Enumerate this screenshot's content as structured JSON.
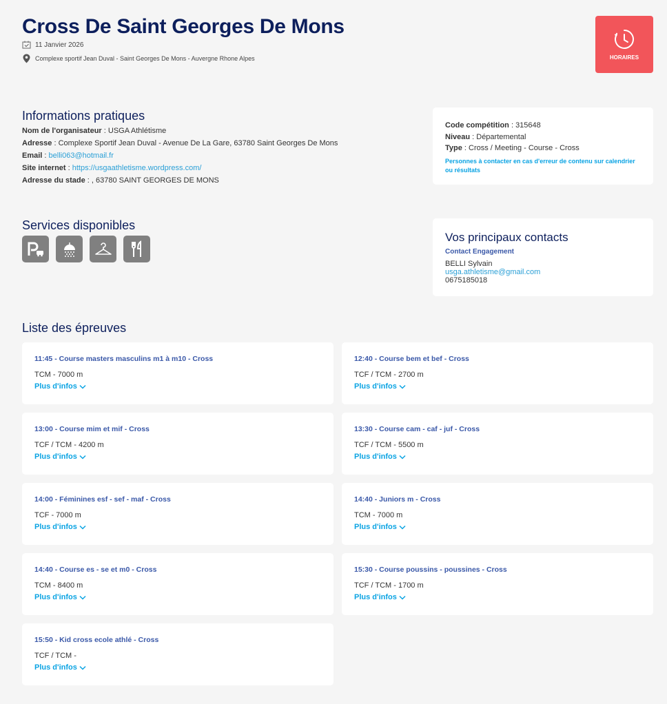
{
  "header": {
    "title": "Cross De Saint Georges De Mons",
    "date": "11 Janvier 2026",
    "location": "Complexe sportif Jean Duval - Saint Georges De Mons - Auvergne Rhone Alpes",
    "horaires_label": "HORAIRES"
  },
  "infos": {
    "title": "Informations pratiques",
    "organisateur_label": "Nom de l'organisateur",
    "organisateur": "USGA Athlétisme",
    "adresse_label": "Adresse",
    "adresse": "Complexe Sportif Jean Duval - Avenue De La Gare, 63780 Saint Georges De Mons",
    "email_label": "Email",
    "email": "belli063@hotmail.fr",
    "site_label": "Site internet",
    "site": "https://usgaathletisme.wordpress.com/",
    "stade_label": "Adresse du stade",
    "stade": ", 63780 SAINT GEORGES DE MONS"
  },
  "competition": {
    "code_label": "Code compétition",
    "code": "315648",
    "niveau_label": "Niveau",
    "niveau": "Départemental",
    "type_label": "Type",
    "type": "Cross / Meeting - Course - Cross",
    "warning": "Personnes à contacter en cas d'erreur de contenu sur calendrier ou résultats"
  },
  "services": {
    "title": "Services disponibles",
    "icons": [
      "parking-icon",
      "shower-icon",
      "cloakroom-icon",
      "restaurant-icon"
    ]
  },
  "contacts": {
    "title": "Vos principaux contacts",
    "subtitle": "Contact Engagement",
    "name": "BELLI Sylvain",
    "email": "usga.athletisme@gmail.com",
    "phone": "0675185018"
  },
  "epreuves": {
    "title": "Liste des épreuves",
    "more_label": "Plus d'infos",
    "items": [
      {
        "title": "11:45 - Course masters masculins m1 à m10 - Cross",
        "dist": "TCM - 7000 m"
      },
      {
        "title": "12:40 - Course bem et bef - Cross",
        "dist": "TCF / TCM - 2700 m"
      },
      {
        "title": "13:00 - Course mim et mif - Cross",
        "dist": "TCF / TCM - 4200 m"
      },
      {
        "title": "13:30 - Course cam - caf - juf - Cross",
        "dist": "TCF / TCM - 5500 m"
      },
      {
        "title": "14:00 - Féminines esf - sef - maf - Cross",
        "dist": "TCF - 7000 m"
      },
      {
        "title": "14:40 - Juniors m - Cross",
        "dist": "TCM - 7000 m"
      },
      {
        "title": "14:40 - Course es - se et m0 - Cross",
        "dist": "TCM - 8400 m"
      },
      {
        "title": "15:30 - Course poussins - poussines - Cross",
        "dist": "TCF / TCM - 1700 m"
      },
      {
        "title": "15:50 - Kid cross ecole athlé - Cross",
        "dist": "TCF / TCM -"
      }
    ]
  },
  "colors": {
    "title": "#0d1f5c",
    "accent": "#f2555a",
    "link": "#0aa3e3",
    "event_title": "#3a58a8"
  }
}
